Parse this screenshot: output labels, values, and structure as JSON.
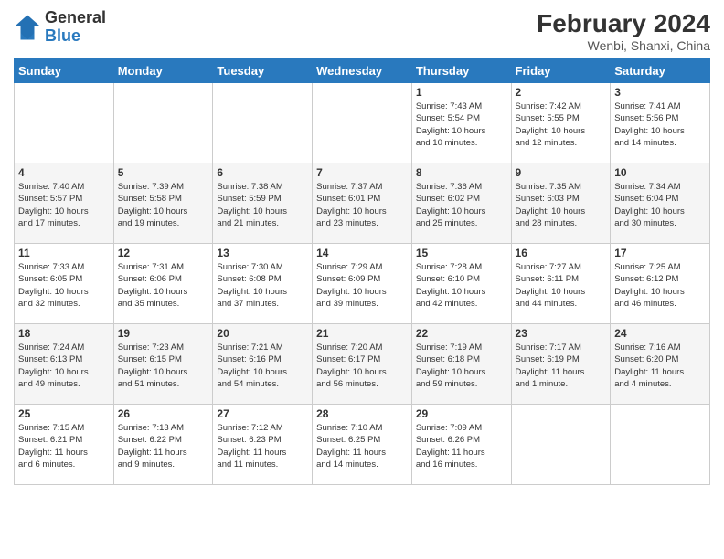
{
  "logo": {
    "line1": "General",
    "line2": "Blue"
  },
  "title": "February 2024",
  "subtitle": "Wenbi, Shanxi, China",
  "days_of_week": [
    "Sunday",
    "Monday",
    "Tuesday",
    "Wednesday",
    "Thursday",
    "Friday",
    "Saturday"
  ],
  "weeks": [
    [
      {
        "day": "",
        "content": ""
      },
      {
        "day": "",
        "content": ""
      },
      {
        "day": "",
        "content": ""
      },
      {
        "day": "",
        "content": ""
      },
      {
        "day": "1",
        "content": "Sunrise: 7:43 AM\nSunset: 5:54 PM\nDaylight: 10 hours\nand 10 minutes."
      },
      {
        "day": "2",
        "content": "Sunrise: 7:42 AM\nSunset: 5:55 PM\nDaylight: 10 hours\nand 12 minutes."
      },
      {
        "day": "3",
        "content": "Sunrise: 7:41 AM\nSunset: 5:56 PM\nDaylight: 10 hours\nand 14 minutes."
      }
    ],
    [
      {
        "day": "4",
        "content": "Sunrise: 7:40 AM\nSunset: 5:57 PM\nDaylight: 10 hours\nand 17 minutes."
      },
      {
        "day": "5",
        "content": "Sunrise: 7:39 AM\nSunset: 5:58 PM\nDaylight: 10 hours\nand 19 minutes."
      },
      {
        "day": "6",
        "content": "Sunrise: 7:38 AM\nSunset: 5:59 PM\nDaylight: 10 hours\nand 21 minutes."
      },
      {
        "day": "7",
        "content": "Sunrise: 7:37 AM\nSunset: 6:01 PM\nDaylight: 10 hours\nand 23 minutes."
      },
      {
        "day": "8",
        "content": "Sunrise: 7:36 AM\nSunset: 6:02 PM\nDaylight: 10 hours\nand 25 minutes."
      },
      {
        "day": "9",
        "content": "Sunrise: 7:35 AM\nSunset: 6:03 PM\nDaylight: 10 hours\nand 28 minutes."
      },
      {
        "day": "10",
        "content": "Sunrise: 7:34 AM\nSunset: 6:04 PM\nDaylight: 10 hours\nand 30 minutes."
      }
    ],
    [
      {
        "day": "11",
        "content": "Sunrise: 7:33 AM\nSunset: 6:05 PM\nDaylight: 10 hours\nand 32 minutes."
      },
      {
        "day": "12",
        "content": "Sunrise: 7:31 AM\nSunset: 6:06 PM\nDaylight: 10 hours\nand 35 minutes."
      },
      {
        "day": "13",
        "content": "Sunrise: 7:30 AM\nSunset: 6:08 PM\nDaylight: 10 hours\nand 37 minutes."
      },
      {
        "day": "14",
        "content": "Sunrise: 7:29 AM\nSunset: 6:09 PM\nDaylight: 10 hours\nand 39 minutes."
      },
      {
        "day": "15",
        "content": "Sunrise: 7:28 AM\nSunset: 6:10 PM\nDaylight: 10 hours\nand 42 minutes."
      },
      {
        "day": "16",
        "content": "Sunrise: 7:27 AM\nSunset: 6:11 PM\nDaylight: 10 hours\nand 44 minutes."
      },
      {
        "day": "17",
        "content": "Sunrise: 7:25 AM\nSunset: 6:12 PM\nDaylight: 10 hours\nand 46 minutes."
      }
    ],
    [
      {
        "day": "18",
        "content": "Sunrise: 7:24 AM\nSunset: 6:13 PM\nDaylight: 10 hours\nand 49 minutes."
      },
      {
        "day": "19",
        "content": "Sunrise: 7:23 AM\nSunset: 6:15 PM\nDaylight: 10 hours\nand 51 minutes."
      },
      {
        "day": "20",
        "content": "Sunrise: 7:21 AM\nSunset: 6:16 PM\nDaylight: 10 hours\nand 54 minutes."
      },
      {
        "day": "21",
        "content": "Sunrise: 7:20 AM\nSunset: 6:17 PM\nDaylight: 10 hours\nand 56 minutes."
      },
      {
        "day": "22",
        "content": "Sunrise: 7:19 AM\nSunset: 6:18 PM\nDaylight: 10 hours\nand 59 minutes."
      },
      {
        "day": "23",
        "content": "Sunrise: 7:17 AM\nSunset: 6:19 PM\nDaylight: 11 hours\nand 1 minute."
      },
      {
        "day": "24",
        "content": "Sunrise: 7:16 AM\nSunset: 6:20 PM\nDaylight: 11 hours\nand 4 minutes."
      }
    ],
    [
      {
        "day": "25",
        "content": "Sunrise: 7:15 AM\nSunset: 6:21 PM\nDaylight: 11 hours\nand 6 minutes."
      },
      {
        "day": "26",
        "content": "Sunrise: 7:13 AM\nSunset: 6:22 PM\nDaylight: 11 hours\nand 9 minutes."
      },
      {
        "day": "27",
        "content": "Sunrise: 7:12 AM\nSunset: 6:23 PM\nDaylight: 11 hours\nand 11 minutes."
      },
      {
        "day": "28",
        "content": "Sunrise: 7:10 AM\nSunset: 6:25 PM\nDaylight: 11 hours\nand 14 minutes."
      },
      {
        "day": "29",
        "content": "Sunrise: 7:09 AM\nSunset: 6:26 PM\nDaylight: 11 hours\nand 16 minutes."
      },
      {
        "day": "",
        "content": ""
      },
      {
        "day": "",
        "content": ""
      }
    ]
  ]
}
